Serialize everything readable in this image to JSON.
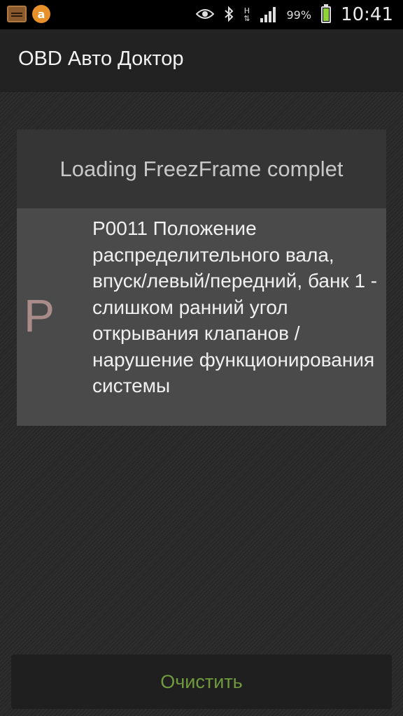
{
  "status_bar": {
    "time": "10:41",
    "battery_percent": "99%",
    "battery_level": 0.99,
    "icons": [
      "car-diagnostic-icon",
      "orange-a-icon",
      "eye-icon",
      "bluetooth-icon",
      "nfc-icon",
      "signal-icon",
      "battery-icon"
    ],
    "nfc_label": "H",
    "colors": {
      "battery_fill": "#8fd13a"
    }
  },
  "action_bar": {
    "title": "OBD Авто Доктор"
  },
  "dialog": {
    "title": "Loading FreezFrame complet",
    "code_letter": "P",
    "code_description": "P0011 Положение распределительного вала, впуск/левый/передний, банк 1 - слишком ранний угол открывания клапанов / нарушение функционирования системы"
  },
  "footer": {
    "clear_label": "Очистить",
    "colors": {
      "label": "#6f9a3e"
    }
  }
}
